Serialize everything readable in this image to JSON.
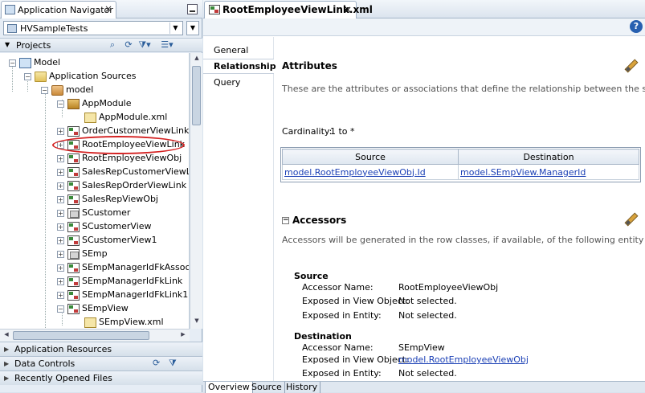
{
  "navigator": {
    "title": "Application Navigator",
    "project_combo": "HVSampleTests",
    "projects_label": "Projects",
    "tree": [
      {
        "label": "Model",
        "icon": "project-icon",
        "level": 0
      },
      {
        "label": "Application Sources",
        "icon": "folder-icon",
        "level": 1
      },
      {
        "label": "model",
        "icon": "package-icon",
        "level": 2
      },
      {
        "label": "AppModule",
        "icon": "appmodule-icon",
        "level": 3
      },
      {
        "label": "AppModule.xml",
        "icon": "xml-icon",
        "level": 4
      },
      {
        "label": "OrderCustomerViewLink",
        "icon": "viewlink-icon",
        "level": 3
      },
      {
        "label": "RootEmployeeViewLink",
        "icon": "viewlink-icon",
        "level": 3
      },
      {
        "label": "RootEmployeeViewObj",
        "icon": "viewlink-icon",
        "level": 3
      },
      {
        "label": "SalesRepCustomerViewLink",
        "icon": "viewlink-icon",
        "level": 3
      },
      {
        "label": "SalesRepOrderViewLink",
        "icon": "viewlink-icon",
        "level": 3
      },
      {
        "label": "SalesRepViewObj",
        "icon": "viewlink-icon",
        "level": 3
      },
      {
        "label": "SCustomer",
        "icon": "entity-icon",
        "level": 3
      },
      {
        "label": "SCustomerView",
        "icon": "viewlink-icon",
        "level": 3
      },
      {
        "label": "SCustomerView1",
        "icon": "viewlink-icon",
        "level": 3
      },
      {
        "label": "SEmp",
        "icon": "entity-icon",
        "level": 3
      },
      {
        "label": "SEmpManagerIdFkAssoc",
        "icon": "viewlink-icon",
        "level": 3
      },
      {
        "label": "SEmpManagerIdFkLink",
        "icon": "viewlink-icon",
        "level": 3
      },
      {
        "label": "SEmpManagerIdFkLink1",
        "icon": "viewlink-icon",
        "level": 3
      },
      {
        "label": "SEmpView",
        "icon": "viewlink-icon",
        "level": 3
      },
      {
        "label": "SEmpView.xml",
        "icon": "xml-icon",
        "level": 4
      }
    ],
    "accordion": [
      "Application Resources",
      "Data Controls",
      "Recently Opened Files"
    ]
  },
  "editor": {
    "tab_title": "RootEmployeeViewLink.xml",
    "side_tabs": [
      "General",
      "Relationship",
      "Query"
    ],
    "active_side_tab": "Relationship",
    "attributes": {
      "heading": "Attributes",
      "description": "These are the attributes or associations that define the relationship between the source and destination view objects.",
      "cardinality_label": "Cardinality:",
      "cardinality_value": "1 to *",
      "table_headers": [
        "Source",
        "Destination"
      ],
      "table_row": [
        "model.RootEmployeeViewObj.Id",
        "model.SEmpView.ManagerId"
      ]
    },
    "accessors": {
      "heading": "Accessors",
      "description": "Accessors will be generated in the row classes, if available, of the following entity and view objects:",
      "source": {
        "heading": "Source",
        "accessor_name_label": "Accessor Name:",
        "accessor_name_value": "RootEmployeeViewObj",
        "exposed_vo_label": "Exposed in View Object:",
        "exposed_vo_value": "Not selected.",
        "exposed_entity_label": "Exposed in Entity:",
        "exposed_entity_value": "Not selected."
      },
      "destination": {
        "heading": "Destination",
        "accessor_name_label": "Accessor Name:",
        "accessor_name_value": "SEmpView",
        "exposed_vo_label": "Exposed in View Object:",
        "exposed_vo_value": "model.RootEmployeeViewObj",
        "exposed_entity_label": "Exposed in Entity:",
        "exposed_entity_value": "Not selected."
      }
    },
    "bottom_tabs": [
      "Overview",
      "Source",
      "History"
    ],
    "active_bottom_tab": "Overview"
  },
  "colors": {
    "highlight_oval": "#d42222",
    "link": "#1a3fb5",
    "help_icon": "#2860b0"
  }
}
